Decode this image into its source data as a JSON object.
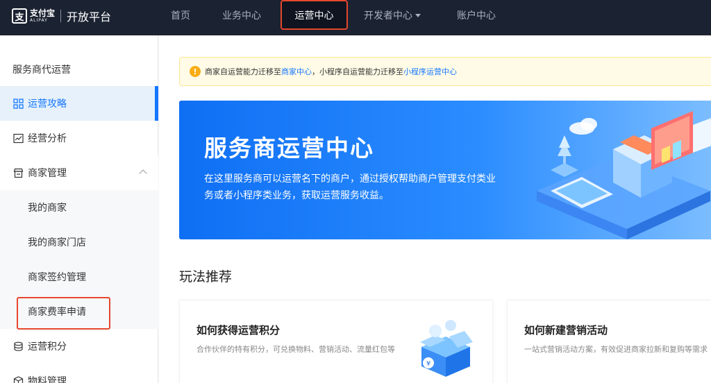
{
  "header": {
    "logo_mark": "支",
    "logo_cn": "支付宝",
    "logo_en": "ALIPAY",
    "platform": "开放平台",
    "nav": [
      {
        "label": "首页"
      },
      {
        "label": "业务中心"
      },
      {
        "label": "运营中心",
        "active": true
      },
      {
        "label": "开发者中心"
      },
      {
        "label": "账户中心"
      }
    ]
  },
  "sidebar": {
    "section": "服务商代运营",
    "items": [
      {
        "label": "运营攻略",
        "icon": "grid-icon",
        "active": true
      },
      {
        "label": "经营分析",
        "icon": "chart-icon"
      },
      {
        "label": "商家管理",
        "icon": "store-icon",
        "expanded": true
      },
      {
        "label": "我的商家",
        "sub": true
      },
      {
        "label": "我的商家门店",
        "sub": true
      },
      {
        "label": "商家签约管理",
        "sub": true
      },
      {
        "label": "商家费率申请",
        "sub": true,
        "highlighted": true
      },
      {
        "label": "运营积分",
        "icon": "coins-icon"
      },
      {
        "label": "物料管理",
        "icon": "box-icon"
      }
    ]
  },
  "notice": {
    "text_1": "商家自运营能力迁移至",
    "link_1": "商家中心",
    "text_2": "，小程序自运营能力迁移至",
    "link_2": "小程序运营中心"
  },
  "banner": {
    "title": "服务商运营中心",
    "description": "在这里服务商可以运营名下的商户，通过授权帮助商户管理支付类业务或者小程序类业务，获取运营服务收益。"
  },
  "section_title": "玩法推荐",
  "cards": [
    {
      "title": "如何获得运营积分",
      "description": "合作伙伴的特有积分，可兑换物料、营销活动、流量红包等"
    },
    {
      "title": "如何新建营销活动",
      "description": "一站式营销活动方案，有效促进商家拉新和复购等需求"
    }
  ],
  "colors": {
    "header_bg": "#1b2231",
    "accent": "#1677ff",
    "highlight": "#e5472d",
    "notice_bg": "#fffbe6"
  }
}
